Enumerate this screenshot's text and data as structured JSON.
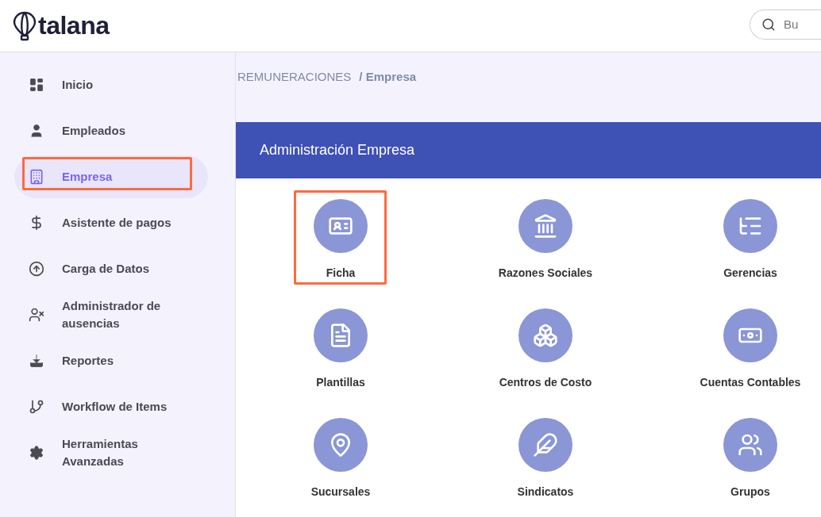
{
  "header": {
    "logo": "talana",
    "search": {
      "placeholder": "Bu"
    }
  },
  "sidebar": {
    "items": [
      {
        "label": "Inicio",
        "selected": false,
        "highlighted": false
      },
      {
        "label": "Empleados",
        "selected": false,
        "highlighted": false
      },
      {
        "label": "Empresa",
        "selected": true,
        "highlighted": true
      },
      {
        "label": "Asistente de pagos",
        "selected": false,
        "highlighted": false
      },
      {
        "label": "Carga de Datos",
        "selected": false,
        "highlighted": false
      },
      {
        "label": "Administrador de ausencias",
        "selected": false,
        "highlighted": false
      },
      {
        "label": "Reportes",
        "selected": false,
        "highlighted": false
      },
      {
        "label": "Workflow de Items",
        "selected": false,
        "highlighted": false
      },
      {
        "label": "Herramientas Avanzadas",
        "selected": false,
        "highlighted": false
      }
    ]
  },
  "breadcrumb": [
    "REMUNERACIONES",
    "/ Empresa"
  ],
  "panel": {
    "title": "Administración Empresa",
    "tiles": [
      {
        "label": "Ficha",
        "highlighted": true
      },
      {
        "label": "Razones Sociales",
        "highlighted": false
      },
      {
        "label": "Gerencias",
        "highlighted": false
      },
      {
        "label": "Plantillas",
        "highlighted": false
      },
      {
        "label": "Centros de Costo",
        "highlighted": false
      },
      {
        "label": "Cuentas Contables",
        "highlighted": false
      },
      {
        "label": "Sucursales",
        "highlighted": false
      },
      {
        "label": "Sindicatos",
        "highlighted": false
      },
      {
        "label": "Grupos",
        "highlighted": false
      }
    ]
  }
}
